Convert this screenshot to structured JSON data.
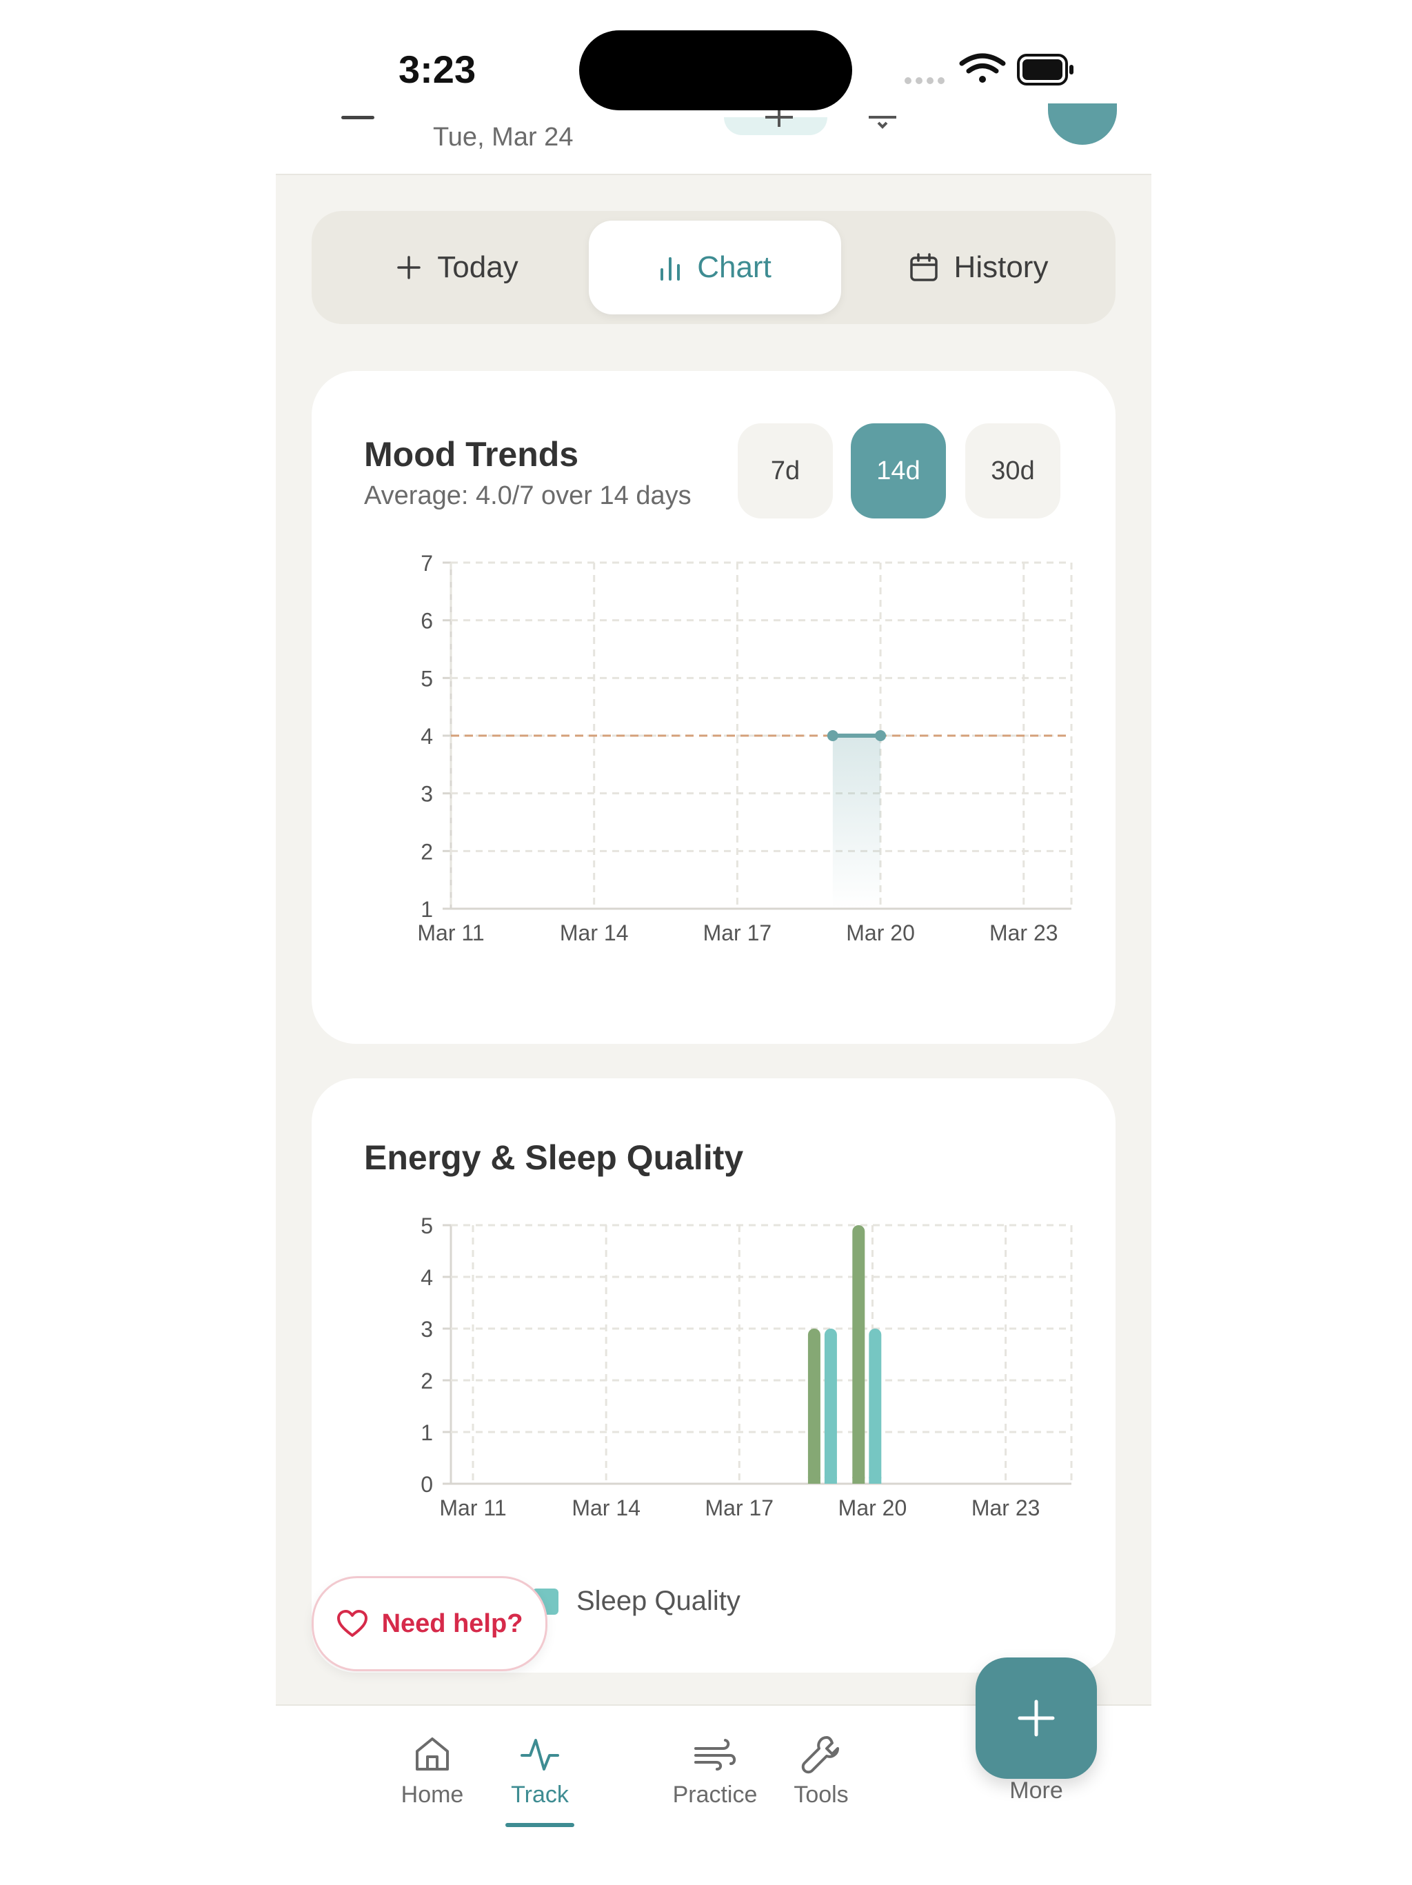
{
  "status_bar": {
    "time": "3:23"
  },
  "header": {
    "date": "Tue, Mar 24"
  },
  "segmented": {
    "today": "Today",
    "chart": "Chart",
    "history": "History"
  },
  "mood_card": {
    "title": "Mood Trends",
    "subtitle": "Average: 4.0/7 over 14 days",
    "ranges": [
      "7d",
      "14d",
      "30d"
    ],
    "selected_range": "14d"
  },
  "energy_card": {
    "title": "Energy & Sleep Quality",
    "legend": {
      "sleep": "Sleep Quality"
    }
  },
  "help_button": {
    "label": "Need help?"
  },
  "tabbar": {
    "items": [
      "Home",
      "Track",
      "Practice",
      "Tools",
      "More"
    ],
    "active": "Track"
  },
  "colors": {
    "accent": "#3e8c92",
    "mood_line": "#6aa3a6",
    "average_line": "#d4a07a",
    "energy_bar": "#85a874",
    "sleep_bar": "#76c6c2",
    "help_red": "#d62a4a"
  },
  "chart_data": [
    {
      "type": "line",
      "title": "Mood Trends",
      "x": [
        "Mar 11",
        "Mar 12",
        "Mar 13",
        "Mar 14",
        "Mar 15",
        "Mar 16",
        "Mar 17",
        "Mar 18",
        "Mar 19",
        "Mar 20",
        "Mar 21",
        "Mar 22",
        "Mar 23",
        "Mar 24"
      ],
      "xticks": [
        "Mar 11",
        "Mar 14",
        "Mar 17",
        "Mar 20",
        "Mar 23"
      ],
      "series": [
        {
          "values": [
            null,
            null,
            null,
            null,
            null,
            null,
            null,
            null,
            4,
            4,
            null,
            null,
            null,
            null
          ]
        }
      ],
      "average": 4.0,
      "yticks": [
        1,
        2,
        3,
        4,
        5,
        6,
        7
      ],
      "ylim": [
        1,
        7
      ],
      "grid": true
    },
    {
      "type": "bar",
      "title": "Energy & Sleep Quality",
      "x": [
        "Mar 11",
        "Mar 12",
        "Mar 13",
        "Mar 14",
        "Mar 15",
        "Mar 16",
        "Mar 17",
        "Mar 18",
        "Mar 19",
        "Mar 20",
        "Mar 21",
        "Mar 22",
        "Mar 23",
        "Mar 24"
      ],
      "xticks": [
        "Mar 11",
        "Mar 14",
        "Mar 17",
        "Mar 20",
        "Mar 23"
      ],
      "series": [
        {
          "values": [
            null,
            null,
            null,
            null,
            null,
            null,
            null,
            null,
            3,
            5,
            null,
            null,
            null,
            null
          ]
        },
        {
          "name": "Sleep Quality",
          "values": [
            null,
            null,
            null,
            null,
            null,
            null,
            null,
            null,
            3,
            3,
            null,
            null,
            null,
            null
          ]
        }
      ],
      "yticks": [
        0,
        1,
        2,
        3,
        4,
        5
      ],
      "ylim": [
        0,
        5
      ],
      "grid": true,
      "legend": "bottom"
    }
  ]
}
